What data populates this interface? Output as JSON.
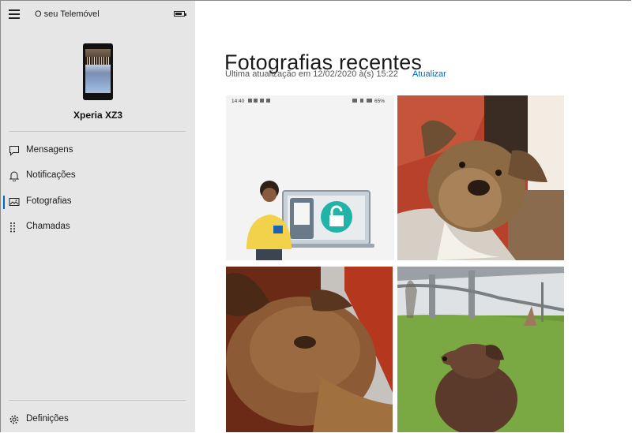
{
  "app": {
    "title": "O seu Telemóvel"
  },
  "device": {
    "name": "Xperia XZ3"
  },
  "nav": {
    "items": [
      {
        "label": "Mensagens",
        "icon": "message-icon"
      },
      {
        "label": "Notificações",
        "icon": "bell-icon"
      },
      {
        "label": "Fotografias",
        "icon": "photos-icon",
        "active": true
      },
      {
        "label": "Chamadas",
        "icon": "dialpad-icon"
      }
    ],
    "settings": {
      "label": "Definições",
      "icon": "gear-icon"
    }
  },
  "main": {
    "title": "Fotografias recentes",
    "last_updated": "Última atualização em 12/02/2020 à(s) 15:22",
    "refresh_label": "Atualizar"
  },
  "photos": {
    "screenshot_status": {
      "time": "14:40",
      "battery": "65%"
    }
  },
  "colors": {
    "accent": "#0067c0",
    "sidebar": "#e6e6e6"
  }
}
